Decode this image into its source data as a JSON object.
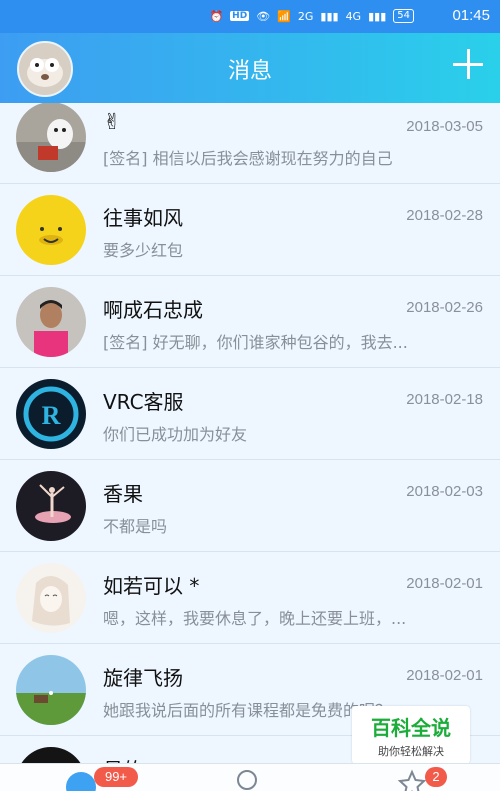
{
  "status_bar": {
    "network_hd": "HD",
    "signal1_label": "2G",
    "signal2_label": "4G",
    "battery": "54",
    "time": "01:45"
  },
  "header": {
    "title": "消息"
  },
  "conversations": [
    {
      "name": "✌",
      "date": "2018-03-05",
      "message": "[签名] 相信以后我会感谢现在努力的自己"
    },
    {
      "name": "往事如风",
      "date": "2018-02-28",
      "message": "要多少红包"
    },
    {
      "name": "啊成石忠成",
      "date": "2018-02-26",
      "message": "[签名] 好无聊，你们谁家种包谷的，我去..."
    },
    {
      "name": "VRC客服",
      "date": "2018-02-18",
      "message": "你们已成功加为好友"
    },
    {
      "name": "香果",
      "date": "2018-02-03",
      "message": "不都是吗"
    },
    {
      "name": "如若可以 *",
      "date": "2018-02-01",
      "message": "嗯，这样，我要休息了，晚上还要上班，..."
    },
    {
      "name": "旋律飞扬",
      "date": "2018-02-01",
      "message": "她跟我说后面的所有课程都是免费的呢？"
    },
    {
      "name": "易的",
      "date": "",
      "message": ""
    }
  ],
  "tabbar": {
    "messages_badge": "99+",
    "favorites_badge": "2"
  },
  "watermark": {
    "title": "百科全说",
    "subtitle": "助你轻松解决"
  },
  "colors": {
    "header_start": "#3d9df2",
    "header_end": "#2ad0ea",
    "list_bg": "#eef7ff",
    "badge": "#f25a4a"
  }
}
